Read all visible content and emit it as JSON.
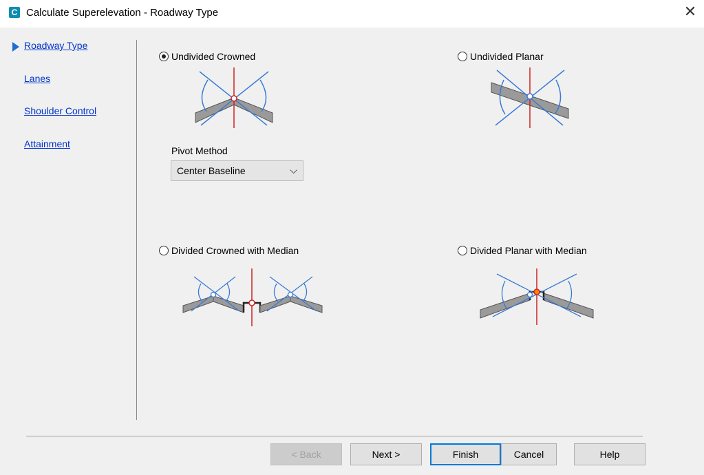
{
  "window": {
    "title": "Calculate Superelevation - Roadway Type",
    "app_icon": "C",
    "close_glyph": "✕"
  },
  "nav": {
    "items": [
      {
        "label": "Roadway Type",
        "active": true
      },
      {
        "label": "Lanes"
      },
      {
        "label": "Shoulder Control"
      },
      {
        "label": "Attainment"
      }
    ]
  },
  "options": {
    "undivided_crowned": {
      "label": "Undivided Crowned",
      "selected": true
    },
    "undivided_planar": {
      "label": "Undivided Planar",
      "selected": false
    },
    "divided_crowned": {
      "label": "Divided Crowned with Median",
      "selected": false
    },
    "divided_planar": {
      "label": "Divided Planar with Median",
      "selected": false
    }
  },
  "pivot": {
    "label": "Pivot Method",
    "value": "Center Baseline",
    "caret": "⌵"
  },
  "buttons": {
    "back": "< Back",
    "next": "Next >",
    "finish": "Finish",
    "cancel": "Cancel",
    "help": "Help"
  },
  "colors": {
    "link": "#0033cc",
    "accent": "#1b6fd1",
    "diagram_blue": "#3a7bd5",
    "baseline_red": "#cc2222",
    "road_gray": "#9a9a9a"
  }
}
